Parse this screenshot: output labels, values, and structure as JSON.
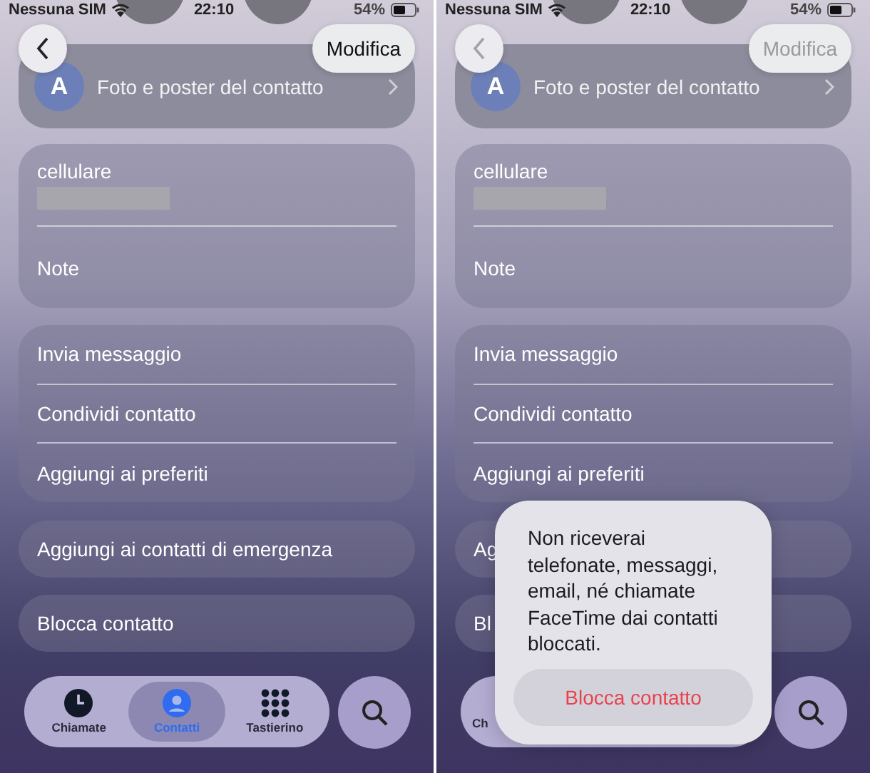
{
  "panels": [
    {
      "status_bar": {
        "carrier": "Nessuna SIM",
        "time": "22:10",
        "battery": "54%"
      },
      "back_button": {
        "disabled": false
      },
      "edit_button": {
        "label": "Modifica",
        "disabled": false
      },
      "photo_row": {
        "avatar": "A",
        "label": "Foto e poster del contatto"
      },
      "phone_field": {
        "label": "cellulare"
      },
      "notes_label": "Note",
      "action_groups": [
        [
          "Invia messaggio",
          "Condividi contatto",
          "Aggiungi ai preferiti"
        ],
        [
          "Aggiungi ai contatti di emergenza"
        ],
        [
          "Blocca contatto"
        ]
      ],
      "tab_bar": {
        "tabs": [
          {
            "kind": "recents",
            "label": "Chiamate",
            "selected": false
          },
          {
            "kind": "contacts",
            "label": "Contatti",
            "selected": true
          },
          {
            "kind": "keypad",
            "label": "Tastierino",
            "selected": false
          }
        ]
      }
    },
    {
      "status_bar": {
        "carrier": "Nessuna SIM",
        "time": "22:10",
        "battery": "54%"
      },
      "back_button": {
        "disabled": true
      },
      "edit_button": {
        "label": "Modifica",
        "disabled": true
      },
      "photo_row": {
        "avatar": "A",
        "label": "Foto e poster del contatto"
      },
      "phone_field": {
        "label": "cellulare"
      },
      "notes_label": "Note",
      "action_groups": [
        [
          "Invia messaggio",
          "Condividi contatto",
          "Aggiungi ai preferiti"
        ],
        [
          "Ag"
        ],
        [
          "Bl"
        ]
      ],
      "tab_bar": {
        "tabs": [
          {
            "label": "Ch",
            "selected": false
          }
        ]
      },
      "alert": {
        "message": "Non riceverai telefonate, messaggi, email, né chiamate FaceTime dai contatti bloccati.",
        "button": "Blocca contatto"
      }
    }
  ]
}
